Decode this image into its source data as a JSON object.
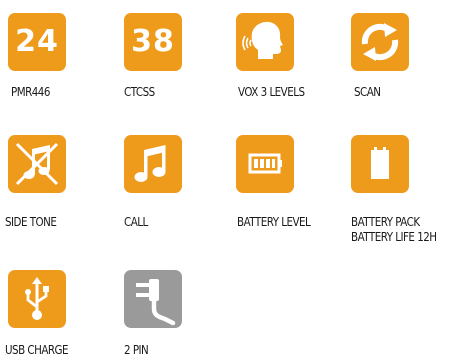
{
  "colors": {
    "orange": "#ee9b1c",
    "grey": "#9a9a9a",
    "icon": "#ffffff",
    "text": "#1a1a1a"
  },
  "features": [
    {
      "label": "PMR446",
      "number": "24",
      "icon": "number-badge",
      "color": "orange"
    },
    {
      "label": "CTCSS",
      "number": "38",
      "icon": "number-badge",
      "color": "orange"
    },
    {
      "label": "VOX 3 LEVELS",
      "icon": "head-voice-icon",
      "color": "orange"
    },
    {
      "label": "SCAN",
      "icon": "scan-arrows-icon",
      "color": "orange"
    },
    {
      "label": "SIDE TONE",
      "icon": "muted-music-note-icon",
      "color": "orange"
    },
    {
      "label": "CALL",
      "icon": "music-note-icon",
      "color": "orange"
    },
    {
      "label": "BATTERY LEVEL",
      "icon": "battery-level-icon",
      "color": "orange"
    },
    {
      "label": "BATTERY PACK",
      "label2": "BATTERY LIFE 12H",
      "icon": "battery-pack-icon",
      "color": "orange"
    },
    {
      "label": "USB CHARGE",
      "icon": "usb-icon",
      "color": "orange"
    },
    {
      "label": "2 PIN",
      "icon": "two-pin-plug-icon",
      "color": "grey"
    }
  ]
}
